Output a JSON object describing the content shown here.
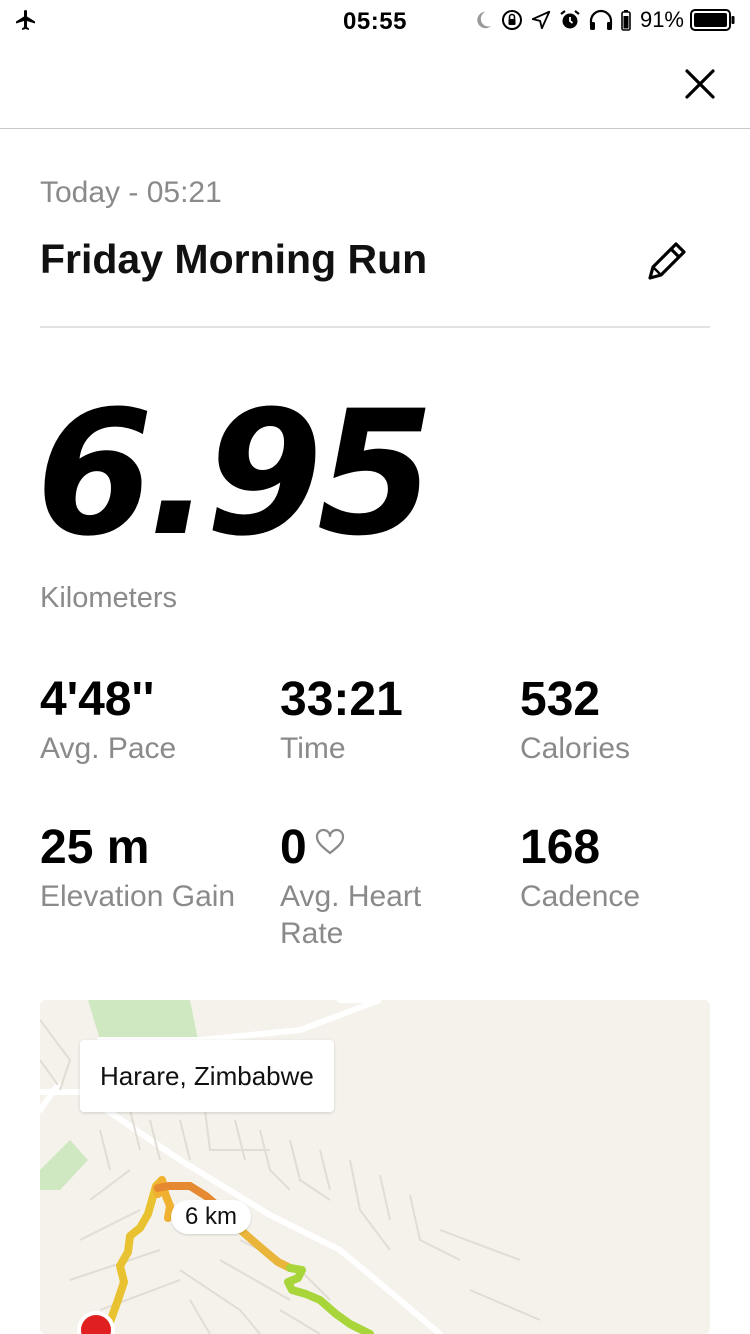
{
  "status_bar": {
    "time": "05:55",
    "battery_percent": "91%",
    "icons": [
      "airplane-icon",
      "moon-icon",
      "rotation-lock-icon",
      "location-arrow-icon",
      "alarm-icon",
      "headphones-icon",
      "battery-icon"
    ]
  },
  "header": {
    "close_icon": "close-icon"
  },
  "activity": {
    "date_line": "Today - 05:21",
    "title": "Friday Morning Run",
    "edit_icon": "pencil-icon"
  },
  "summary": {
    "distance": "6.95",
    "distance_unit": "Kilometers"
  },
  "stats": [
    {
      "value": "4'48''",
      "label": "Avg. Pace"
    },
    {
      "value": "33:21",
      "label": "Time"
    },
    {
      "value": "532",
      "label": "Calories"
    },
    {
      "value": "25 m",
      "label": "Elevation Gain"
    },
    {
      "value": "0",
      "label": "Avg. Heart Rate",
      "icon": "heart-icon"
    },
    {
      "value": "168",
      "label": "Cadence"
    }
  ],
  "map": {
    "location": "Harare, Zimbabwe",
    "km_marker": "6 km",
    "colors": {
      "route_slow": "#e0492c",
      "route_mid": "#f0a030",
      "route_fast": "#9ed32a",
      "start_pin": "#e02020"
    }
  }
}
